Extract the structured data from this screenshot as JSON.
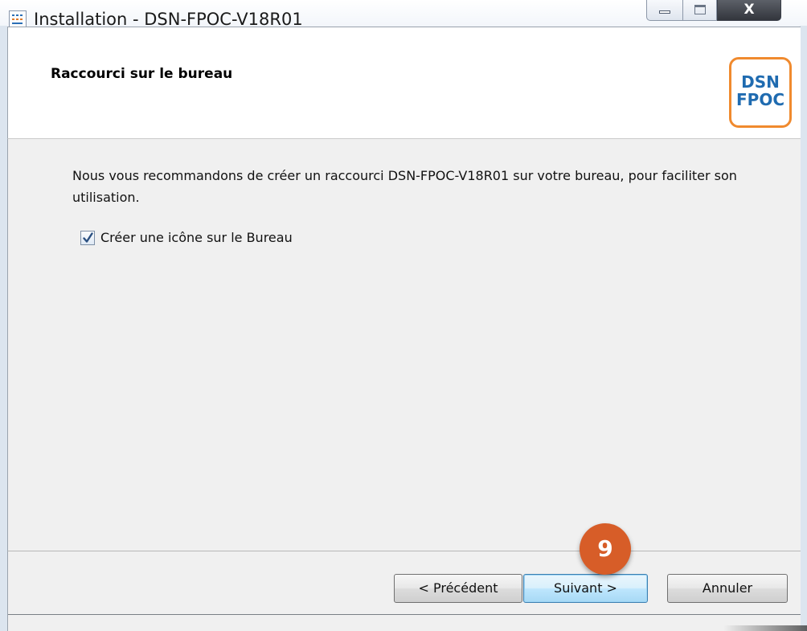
{
  "window": {
    "title": "Installation - DSN-FPOC-V18R01",
    "icon": "installer-app-icon",
    "controls": {
      "minimize": "minimize",
      "maximize": "maximize",
      "close": "X"
    }
  },
  "header": {
    "title": "Raccourci sur le bureau",
    "logo": {
      "line1": "DSN",
      "line2": "FPOC"
    }
  },
  "body": {
    "description": "Nous vous recommandons de créer un raccourci DSN-FPOC-V18R01 sur votre bureau, pour faciliter son utilisation.",
    "checkbox": {
      "label": "Créer une icône sur le Bureau",
      "checked": true
    }
  },
  "footer": {
    "buttons": {
      "previous": "< Précédent",
      "next": "Suivant >",
      "cancel": "Annuler"
    }
  },
  "callout": {
    "step": "9"
  },
  "colors": {
    "accent": "#d75d28",
    "logo_border": "#f08a2e",
    "logo_text": "#1f6bb0",
    "focus_button": "#3c7fb1"
  }
}
